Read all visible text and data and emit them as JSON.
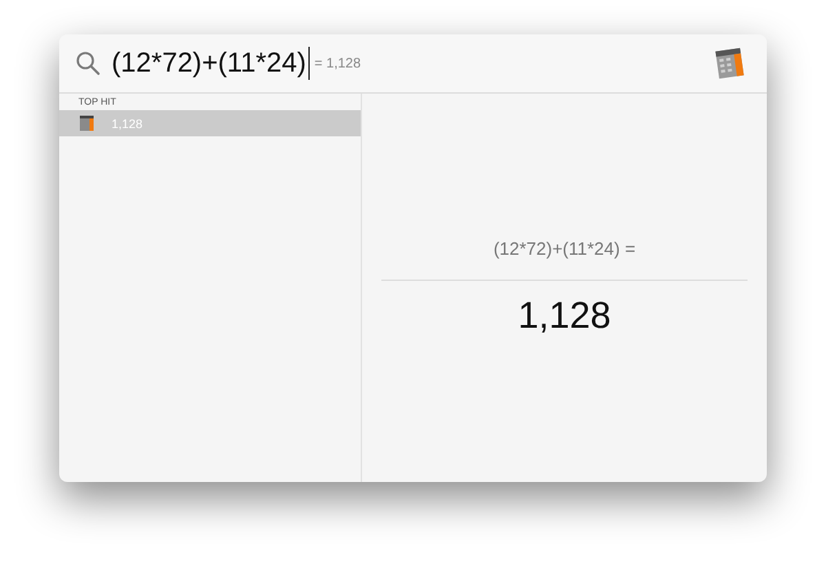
{
  "search": {
    "query": "(12*72)+(11*24)",
    "suggestion": "= 1,128"
  },
  "results": {
    "section": "TOP HIT",
    "items": [
      {
        "label": "1,128",
        "selected": true
      }
    ]
  },
  "preview": {
    "expression": "(12*72)+(11*24) =",
    "result": "1,128"
  }
}
